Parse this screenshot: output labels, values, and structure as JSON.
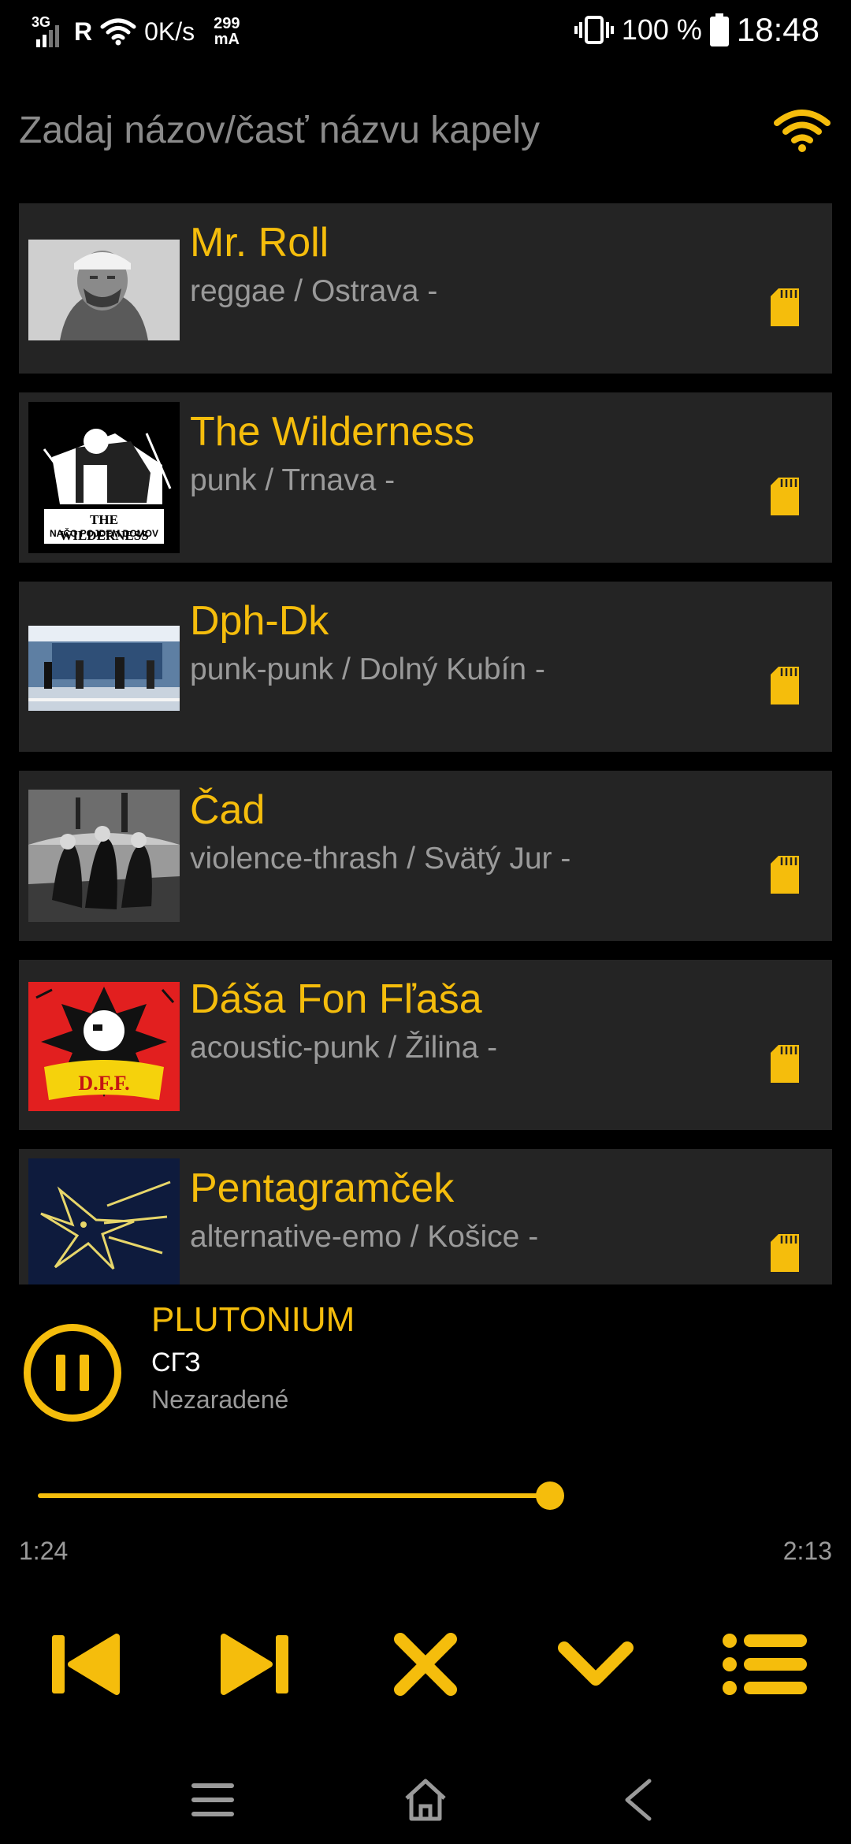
{
  "status_bar": {
    "network": "3G",
    "roaming": "R",
    "speed": "0K/s",
    "current_value": "299",
    "current_unit": "mA",
    "battery": "100 %",
    "time": "18:48"
  },
  "search": {
    "placeholder": "Zadaj názov/časť názvu kapely"
  },
  "bands": [
    {
      "name": "Mr. Roll",
      "meta": "reggae / Ostrava -"
    },
    {
      "name": "The Wilderness",
      "meta": "punk / Trnava -",
      "thumb_text_1": "THE WILDERNESS",
      "thumb_text_2": "NAČO POJDEM DOMOV"
    },
    {
      "name": "Dph-Dk",
      "meta": "punk-punk / Dolný Kubín -"
    },
    {
      "name": "Čad",
      "meta": "violence-thrash / Svätý Jur -"
    },
    {
      "name": "Dáša Fon Fľaša",
      "meta": "acoustic-punk / Žilina -",
      "thumb_text_1": "D.F.F."
    },
    {
      "name": "Pentagramček",
      "meta": "alternative-emo / Košice -"
    }
  ],
  "player": {
    "title": "PLUTONIUM",
    "artist": "СГЗ",
    "genre": "Nezaradené",
    "time_current": "1:24",
    "time_total": "2:13",
    "progress": 0.63
  },
  "colors": {
    "accent": "#f5bd0c",
    "card": "#242424",
    "background": "#000000",
    "muted_text": "#9a9a9a"
  },
  "icons": {
    "search_mode": "wifi-icon",
    "offline_badge": "sd-card-icon",
    "play_state": "pause-icon",
    "controls": [
      "skip-previous-icon",
      "skip-next-icon",
      "close-icon",
      "chevron-down-icon",
      "playlist-icon"
    ],
    "nav": [
      "recents-icon",
      "home-icon",
      "back-icon"
    ]
  }
}
